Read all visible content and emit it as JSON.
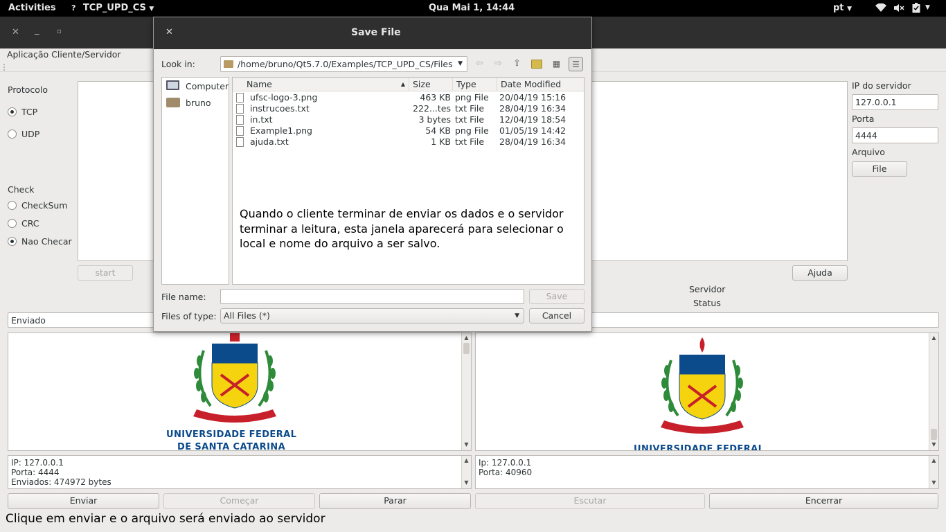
{
  "topbar": {
    "activities": "Activities",
    "app_menu": "TCP_UPD_CS",
    "clock": "Qua Mai  1, 14:44",
    "lang": "pt"
  },
  "main": {
    "menu_title": "Aplicação Cliente/Servidor",
    "protocolo_label": "Protocolo",
    "protocol_options": [
      "TCP",
      "UDP"
    ],
    "protocol_selected": "TCP",
    "check_label": "Check",
    "check_options": [
      "CheckSum",
      "CRC",
      "Nao Checar"
    ],
    "check_selected": "Nao Checar",
    "start_button": "start",
    "ajuda_button": "Ajuda",
    "ip_label": "IP do servidor",
    "ip_value": "127.0.0.1",
    "porta_label": "Porta",
    "porta_value": "4444",
    "arquivo_label": "Arquivo",
    "file_button": "File",
    "servidor_label": "Servidor",
    "status_label": "Status",
    "enviado_field": "Enviado",
    "logo_line1": "UNIVERSIDADE FEDERAL",
    "logo_line2": "DE SANTA CATARINA",
    "logo_line1_right": "UNIVERSIDADE FEDERAL",
    "client_log": [
      "IP: 127.0.0.1",
      "Porta: 4444",
      "Enviados: 474972 bytes"
    ],
    "server_log": [
      "Ip: 127.0.0.1",
      "Porta: 40960"
    ],
    "buttons": {
      "enviar": "Enviar",
      "comecar": "Começar",
      "parar": "Parar",
      "escutar": "Escutar",
      "encerrar": "Encerrar"
    },
    "status_message": "Clique em enviar e o arquivo será enviado ao servidor"
  },
  "dialog": {
    "title": "Save File",
    "look_in_label": "Look in:",
    "path": "/home/bruno/Qt5.7.0/Examples/TCP_UPD_CS/Files",
    "places": [
      "Computer",
      "bruno"
    ],
    "columns": [
      "Name",
      "Size",
      "Type",
      "Date Modified"
    ],
    "files": [
      {
        "name": "ufsc-logo-3.png",
        "size": "463 KB",
        "type": "png File",
        "date": "20/04/19 15:16"
      },
      {
        "name": "instrucoes.txt",
        "size": "222...tes",
        "type": "txt File",
        "date": "28/04/19 16:34"
      },
      {
        "name": "in.txt",
        "size": "3 bytes",
        "type": "txt File",
        "date": "12/04/19 18:54"
      },
      {
        "name": "Example1.png",
        "size": "54 KB",
        "type": "png File",
        "date": "01/05/19 14:42"
      },
      {
        "name": "ajuda.txt",
        "size": "1 KB",
        "type": "txt File",
        "date": "28/04/19 16:34"
      }
    ],
    "annotation": "Quando o cliente terminar de enviar os dados e o servidor terminar a leitura, esta janela aparecerá para selecionar o local e nome do arquivo a ser salvo.",
    "filename_label": "File name:",
    "filename_value": "",
    "save_button": "Save",
    "filetype_label": "Files of type:",
    "filetype_value": "All Files (*)",
    "cancel_button": "Cancel"
  },
  "colors": {
    "topbar": "#000000",
    "titlebar": "#2f2f2f",
    "window_bg": "#edebe9",
    "logo_blue": "#0b4a8b",
    "logo_red": "#c8202a",
    "logo_green": "#2e8b3a",
    "logo_yellow": "#f5d40f"
  }
}
